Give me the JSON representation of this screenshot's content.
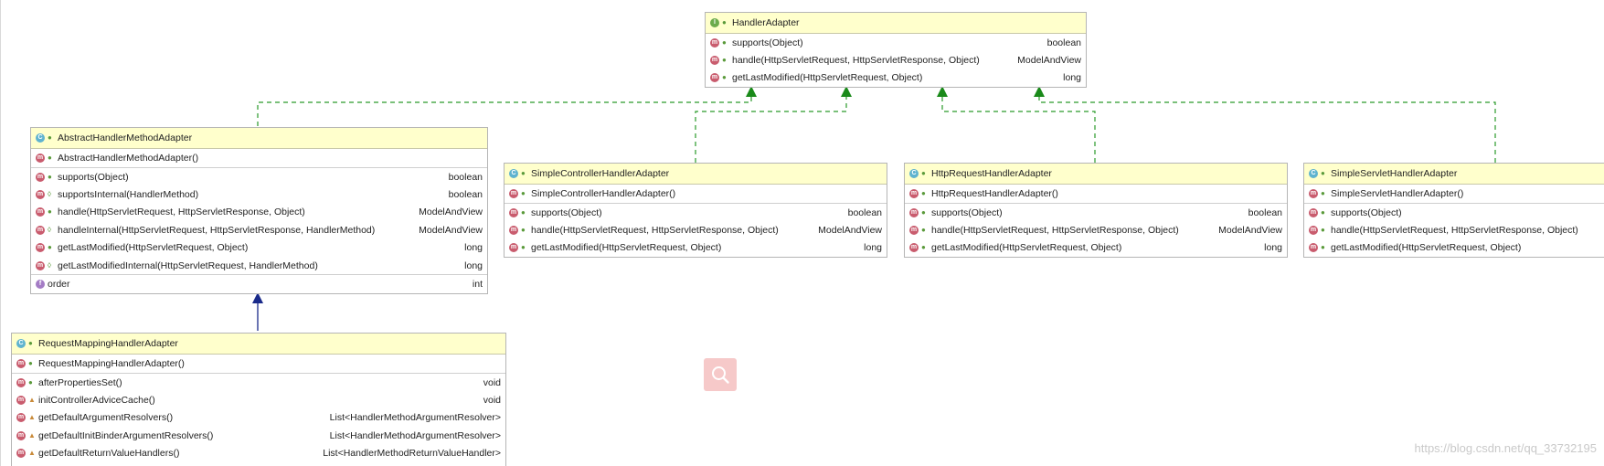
{
  "diagram": {
    "handler_adapter": {
      "name": "HandlerAdapter",
      "methods": [
        {
          "name": "supports(Object)",
          "type": "boolean"
        },
        {
          "name": "handle(HttpServletRequest, HttpServletResponse, Object)",
          "type": "ModelAndView"
        },
        {
          "name": "getLastModified(HttpServletRequest, Object)",
          "type": "long"
        }
      ]
    },
    "abstract_adapter": {
      "name": "AbstractHandlerMethodAdapter",
      "ctor": "AbstractHandlerMethodAdapter()",
      "methods": [
        {
          "name": "supports(Object)",
          "type": "boolean"
        },
        {
          "name": "supportsInternal(HandlerMethod)",
          "type": "boolean"
        },
        {
          "name": "handle(HttpServletRequest, HttpServletResponse, Object)",
          "type": "ModelAndView"
        },
        {
          "name": "handleInternal(HttpServletRequest, HttpServletResponse, HandlerMethod)",
          "type": "ModelAndView"
        },
        {
          "name": "getLastModified(HttpServletRequest, Object)",
          "type": "long"
        },
        {
          "name": "getLastModifiedInternal(HttpServletRequest, HandlerMethod)",
          "type": "long"
        }
      ],
      "field": {
        "name": "order",
        "type": "int"
      }
    },
    "simple_controller": {
      "name": "SimpleControllerHandlerAdapter",
      "ctor": "SimpleControllerHandlerAdapter()",
      "methods": [
        {
          "name": "supports(Object)",
          "type": "boolean"
        },
        {
          "name": "handle(HttpServletRequest, HttpServletResponse, Object)",
          "type": "ModelAndView"
        },
        {
          "name": "getLastModified(HttpServletRequest, Object)",
          "type": "long"
        }
      ]
    },
    "http_request": {
      "name": "HttpRequestHandlerAdapter",
      "ctor": "HttpRequestHandlerAdapter()",
      "methods": [
        {
          "name": "supports(Object)",
          "type": "boolean"
        },
        {
          "name": "handle(HttpServletRequest, HttpServletResponse, Object)",
          "type": "ModelAndView"
        },
        {
          "name": "getLastModified(HttpServletRequest, Object)",
          "type": "long"
        }
      ]
    },
    "simple_servlet": {
      "name": "SimpleServletHandlerAdapter",
      "ctor": "SimpleServletHandlerAdapter()",
      "methods": [
        {
          "name": "supports(Object)",
          "type": ""
        },
        {
          "name": "handle(HttpServletRequest, HttpServletResponse, Object)",
          "type": ""
        },
        {
          "name": "getLastModified(HttpServletRequest, Object)",
          "type": ""
        }
      ]
    },
    "request_mapping": {
      "name": "RequestMappingHandlerAdapter",
      "ctor": "RequestMappingHandlerAdapter()",
      "methods": [
        {
          "name": "afterPropertiesSet()",
          "type": "void"
        },
        {
          "name": "initControllerAdviceCache()",
          "type": "void"
        },
        {
          "name": "getDefaultArgumentResolvers()",
          "type": "List<HandlerMethodArgumentResolver>"
        },
        {
          "name": "getDefaultInitBinderArgumentResolvers()",
          "type": "List<HandlerMethodArgumentResolver>"
        },
        {
          "name": "getDefaultReturnValueHandlers()",
          "type": "List<HandlerMethodReturnValueHandler>"
        }
      ]
    }
  },
  "icons": {
    "interface": "I",
    "class": "C",
    "method": "m",
    "field": "f"
  },
  "watermark": "https://blog.csdn.net/qq_33732195"
}
